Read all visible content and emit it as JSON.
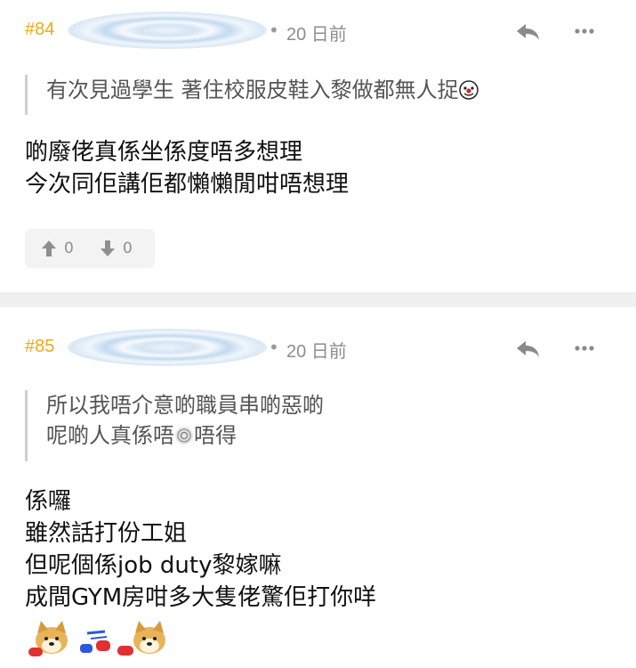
{
  "posts": [
    {
      "floor": "#84",
      "separator": "•",
      "time": "20 日前",
      "quote": [
        "有次見過學生 著住校服皮鞋入黎做都無人捉"
      ],
      "body": [
        "啲廢佬真係坐係度唔多想理",
        "今次同佢講佢都懶懶閒咁唔想理"
      ],
      "upvotes": "0",
      "downvotes": "0"
    },
    {
      "floor": "#85",
      "separator": "•",
      "time": "20 日前",
      "quote": [
        "所以我唔介意啲職員串啲惡啲",
        "呢啲人真係唔",
        "唔得"
      ],
      "body": [
        "係囉",
        "雖然話打份工姐",
        "但呢個係job duty黎嫁嘛",
        "成間GYM房咁多大隻佬驚佢打你咩"
      ]
    }
  ],
  "icons": [
    "reply-icon",
    "more-icon",
    "upvote-icon",
    "downvote-icon",
    "clown-emoji-icon",
    "spiral-emoji-icon",
    "doge-boxing-sticker"
  ]
}
